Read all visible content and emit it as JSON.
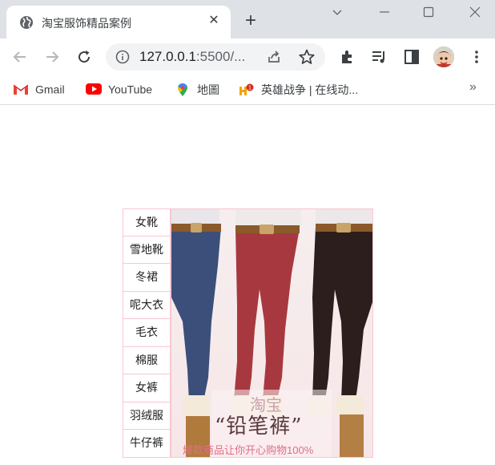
{
  "browser": {
    "tab": {
      "title": "淘宝服饰精品案例"
    },
    "url": {
      "host": "127.0.0.1",
      "rest": ":5500/..."
    },
    "bookmarks": [
      {
        "label": "Gmail",
        "icon": "gmail-icon"
      },
      {
        "label": "YouTube",
        "icon": "youtube-icon"
      },
      {
        "label": "地圖",
        "icon": "maps-icon"
      },
      {
        "label": "英雄战争 | 在线动...",
        "icon": "game-icon"
      }
    ],
    "bookmarks_more": "»"
  },
  "page": {
    "menu": [
      "女靴",
      "雪地靴",
      "冬裙",
      "呢大衣",
      "毛衣",
      "棉服",
      "女裤",
      "羽绒服",
      "牛仔裤"
    ],
    "banner": {
      "brand": "淘宝",
      "headline": "“铅笔裤”",
      "tagline": "爆款商品让你开心购物100%"
    }
  },
  "colors": {
    "menu_border": "#f8c7d2",
    "jeans_blue": "#3b4f7a",
    "jeans_red": "#a8383f",
    "jeans_black": "#2b1e1c"
  }
}
